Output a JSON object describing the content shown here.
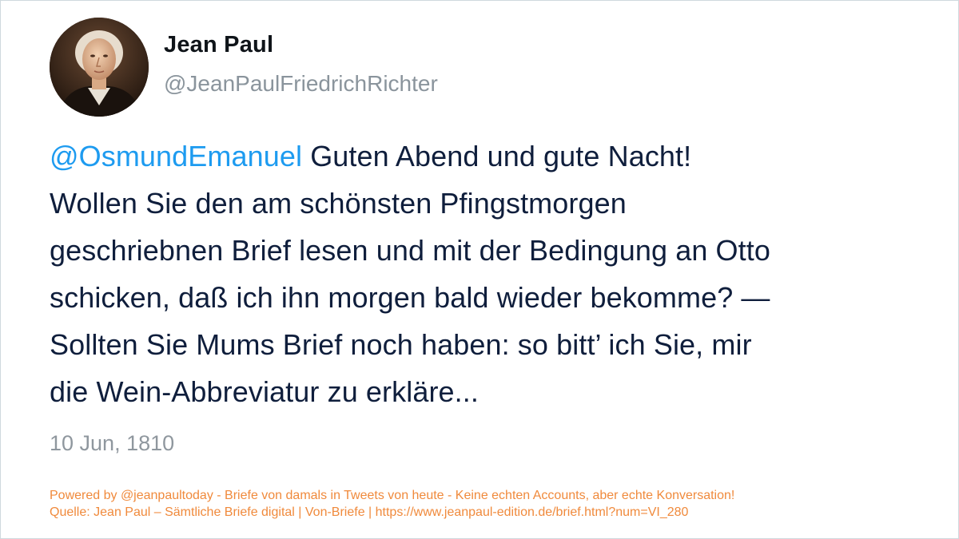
{
  "author": {
    "name": "Jean Paul",
    "handle": "@JeanPaulFriedrichRichter"
  },
  "tweet": {
    "mention": "@OsmundEmanuel",
    "lines": [
      " Guten Abend und gute Nacht!",
      "Wollen Sie den am schönsten Pfingstmorgen",
      "geschriebnen Brief lesen und mit der Bedingung an Otto",
      "schicken, daß ich ihn morgen bald wieder bekomme? —",
      "Sollten Sie Mums Brief noch haben: so bitt’ ich Sie, mir",
      "die Wein-Abbreviatur zu erkläre..."
    ]
  },
  "date": "10 Jun, 1810",
  "footer": {
    "line1": "Powered by @jeanpaultoday - Briefe von damals in Tweets von heute - Keine echten Accounts, aber echte Konversation!",
    "line2": "Quelle: Jean Paul – Sämtliche Briefe digital | Von-Briefe | https://www.jeanpaul-edition.de/brief.html?num=VI_280"
  },
  "colors": {
    "mention": "#1d9bf0",
    "text": "#0f1e3c",
    "muted": "#8f979e",
    "footer": "#f08a3c"
  },
  "icons": {
    "avatar": "portrait-avatar"
  }
}
